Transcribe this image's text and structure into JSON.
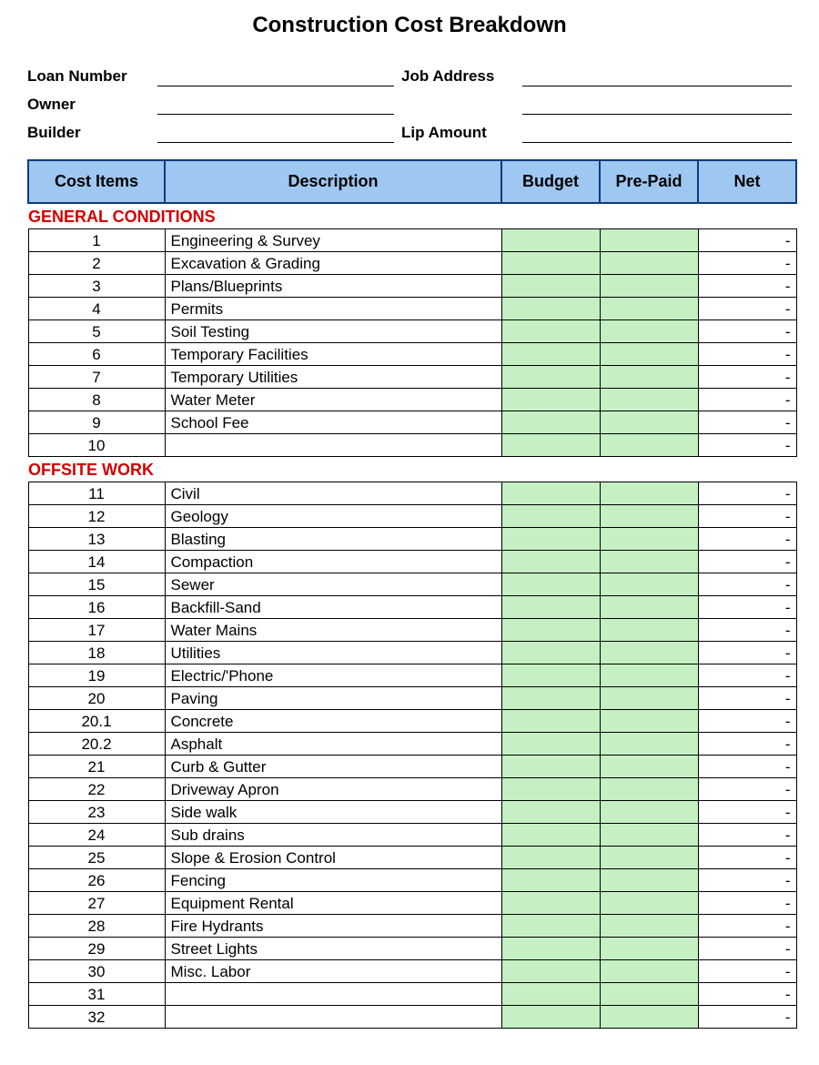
{
  "title": "Construction Cost Breakdown",
  "info": {
    "loan_number_label": "Loan Number",
    "owner_label": "Owner",
    "builder_label": "Builder",
    "job_address_label": "Job Address",
    "lip_amount_label": "Lip Amount"
  },
  "columns": {
    "cost_items": "Cost  Items",
    "description": "Description",
    "budget": "Budget",
    "pre_paid": "Pre-Paid",
    "net": "Net"
  },
  "net_dash": "-",
  "sections": [
    {
      "heading": "GENERAL CONDITIONS",
      "rows": [
        {
          "num": "1",
          "desc": "Engineering & Survey"
        },
        {
          "num": "2",
          "desc": "Excavation & Grading"
        },
        {
          "num": "3",
          "desc": "Plans/Blueprints"
        },
        {
          "num": "4",
          "desc": "Permits"
        },
        {
          "num": "5",
          "desc": "Soil Testing"
        },
        {
          "num": "6",
          "desc": "Temporary Facilities"
        },
        {
          "num": "7",
          "desc": "Temporary Utilities"
        },
        {
          "num": "8",
          "desc": "Water Meter"
        },
        {
          "num": "9",
          "desc": "School Fee"
        },
        {
          "num": "10",
          "desc": ""
        }
      ]
    },
    {
      "heading": "OFFSITE WORK",
      "rows": [
        {
          "num": "11",
          "desc": "Civil"
        },
        {
          "num": "12",
          "desc": "Geology"
        },
        {
          "num": "13",
          "desc": "Blasting"
        },
        {
          "num": "14",
          "desc": "Compaction"
        },
        {
          "num": "15",
          "desc": "Sewer"
        },
        {
          "num": "16",
          "desc": "Backfill-Sand"
        },
        {
          "num": "17",
          "desc": "Water Mains"
        },
        {
          "num": "18",
          "desc": "Utilities"
        },
        {
          "num": "19",
          "desc": "Electric/'Phone"
        },
        {
          "num": "20",
          "desc": "Paving"
        },
        {
          "num": "20.1",
          "desc": "Concrete"
        },
        {
          "num": "20.2",
          "desc": "Asphalt"
        },
        {
          "num": "21",
          "desc": "Curb & Gutter"
        },
        {
          "num": "22",
          "desc": "Driveway Apron"
        },
        {
          "num": "23",
          "desc": "Side walk"
        },
        {
          "num": "24",
          "desc": "Sub drains"
        },
        {
          "num": "25",
          "desc": "Slope & Erosion Control"
        },
        {
          "num": "26",
          "desc": "Fencing"
        },
        {
          "num": "27",
          "desc": "Equipment Rental"
        },
        {
          "num": "28",
          "desc": "Fire Hydrants"
        },
        {
          "num": "29",
          "desc": "Street Lights"
        },
        {
          "num": "30",
          "desc": "Misc. Labor"
        },
        {
          "num": "31",
          "desc": ""
        },
        {
          "num": "32",
          "desc": ""
        }
      ]
    }
  ]
}
